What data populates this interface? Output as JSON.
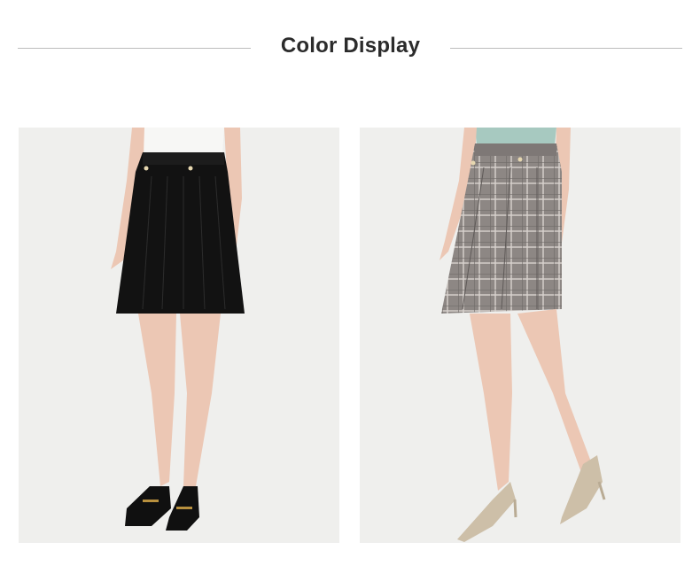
{
  "section": {
    "title": "Color Display"
  },
  "products": [
    {
      "variant": "black",
      "skirt_color": "#121212",
      "shoe_color": "#101010"
    },
    {
      "variant": "plaid",
      "skirt_color": "#8d8784",
      "shoe_color": "#cdbfa8"
    }
  ],
  "colors": {
    "background": "#ffffff",
    "photo_background": "#efefed",
    "rule": "#bdbdbd",
    "title": "#2b2b2b",
    "skin": "#ecc7b4"
  }
}
